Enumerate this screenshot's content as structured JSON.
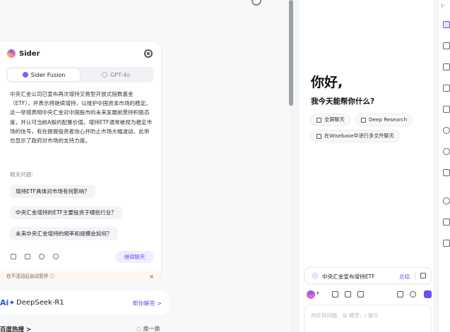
{
  "sider_card": {
    "title": "Sider",
    "tabs": [
      {
        "label": "Sider Fusion",
        "active": true
      },
      {
        "label": "GPT-4o",
        "active": false
      }
    ],
    "answer": "中央汇金公司已宣布再次增持交易型开放式指数基金（ETF），并表示将继续增持，以维护中国资本市场的稳定。这一举措表明中央汇金对中国股市的未来发展前景持积极态度，并认可当前A股的配置价值。增持ETF通常被视为稳定市场的信号，有在提振投资者信心并防止市场大幅波动。此举也显示了政府对市场的支持力度。",
    "related_title": "相关问题:",
    "related": [
      "增持ETF具体对市场有何影响？",
      "中央汇金增持的ETF主要投资于哪些行业？",
      "未来中央汇金增持的频率和规模会如何？"
    ],
    "continue_label": "继续聊天",
    "pause_text": "在不活动后自动暂停 ⓘ",
    "pause_close": "×"
  },
  "deepseek": {
    "logo": "Ai✦",
    "name": "DeepSeek-R1",
    "link": "帮你解答 >"
  },
  "hot": {
    "title": "百度热搜 >",
    "refresh": "◌ 换一换"
  },
  "panel": {
    "greeting": "你好,",
    "subtitle": "我今天能帮你什么?",
    "chips": [
      "全屏聊天",
      "Deep Research",
      "在Wisebase中进行多文件聊天"
    ],
    "quote_text": "中央汇金宣布增持ETF",
    "quote_summary": "总结",
    "input_placeholder": "向任何问题，@ 模型，/ 提示"
  },
  "rail": {
    "top": "|‹"
  },
  "colors": {
    "accent": "#6b4cf6",
    "accent_light": "#f0eefe"
  }
}
